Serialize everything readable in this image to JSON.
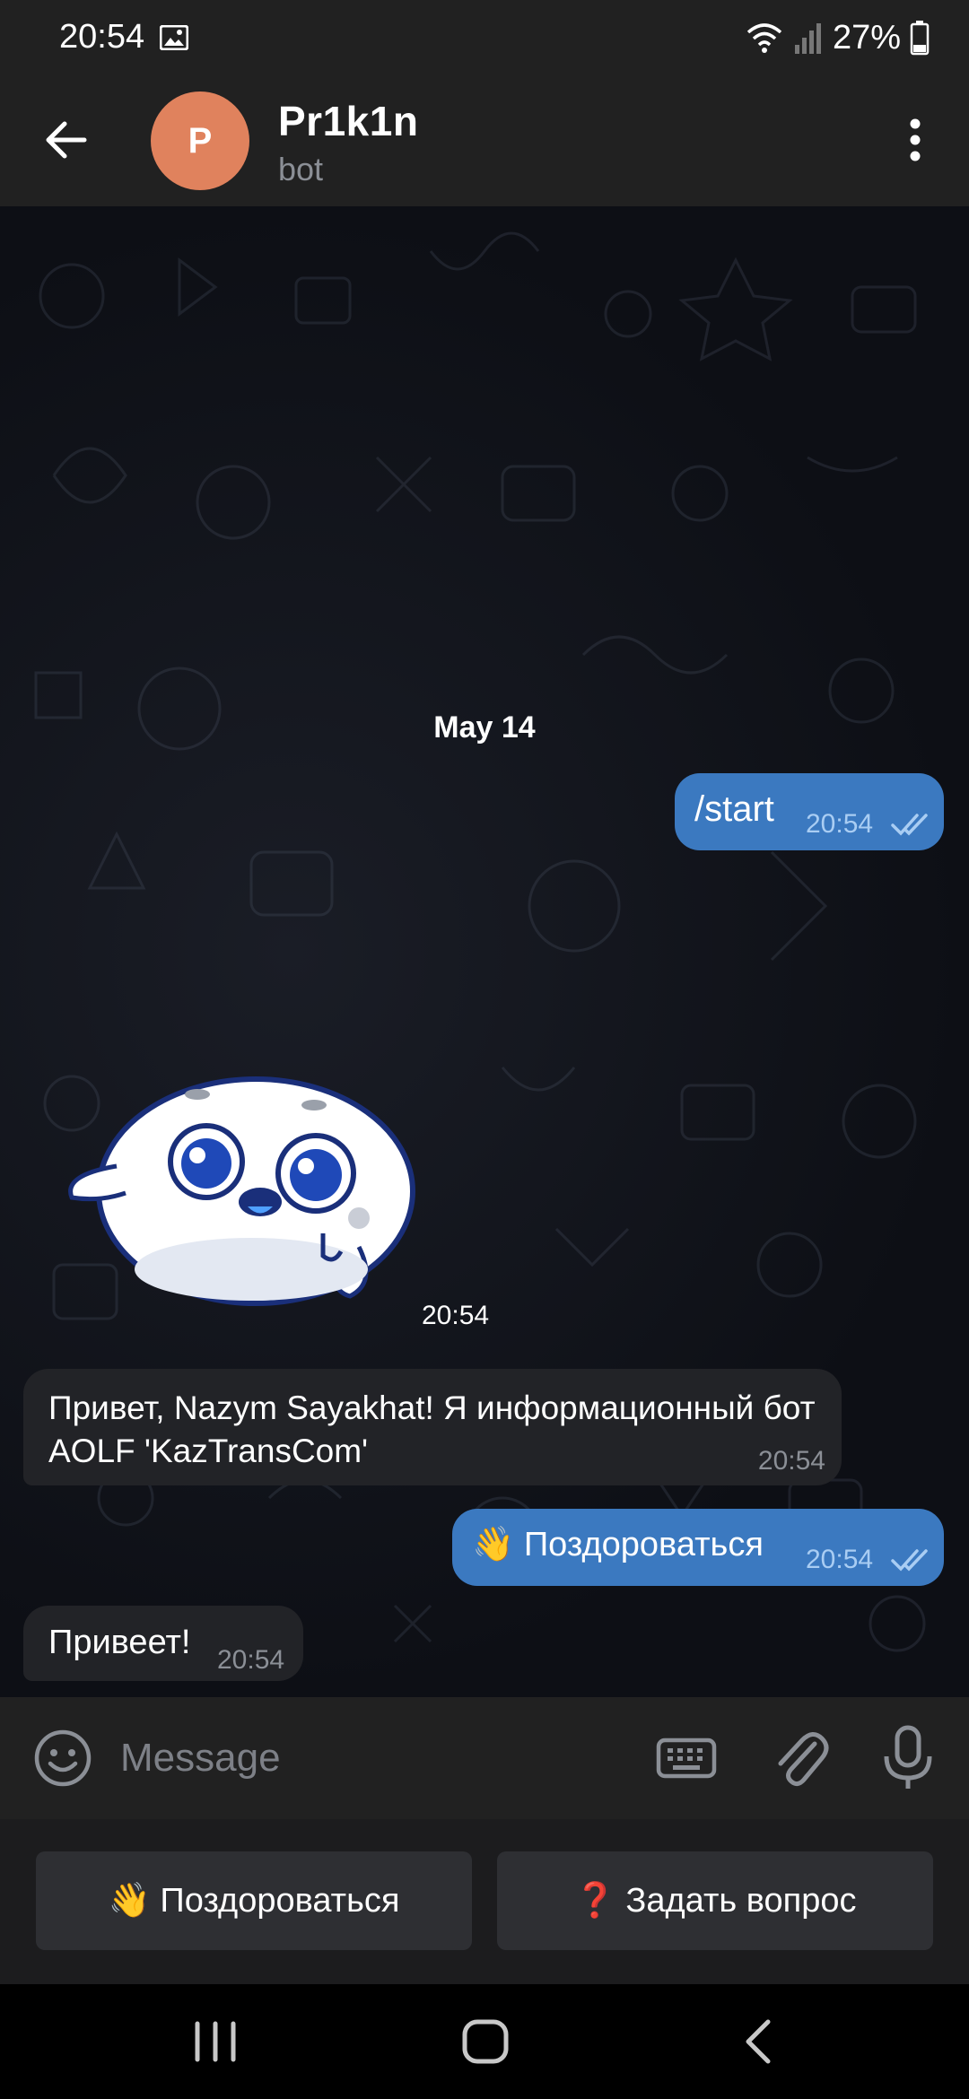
{
  "status_bar": {
    "time": "20:54",
    "battery": "27%"
  },
  "header": {
    "title": "Pr1k1n",
    "subtitle": "bot",
    "avatar_letter": "P",
    "avatar_color": "#e0825d"
  },
  "chat": {
    "date": "May 14",
    "messages": [
      {
        "direction": "out",
        "text": "/start",
        "time": "20:54"
      },
      {
        "direction": "in",
        "type": "sticker",
        "time": "20:54"
      },
      {
        "direction": "in",
        "text": "Привет, Nazym Sayakhat! Я информационный бот AOLF 'KazTransCom'",
        "time": "20:54"
      },
      {
        "direction": "out",
        "text": "👋 Поздороваться",
        "time": "20:54"
      },
      {
        "direction": "in",
        "text": "Привеет!",
        "time": "20:54"
      }
    ]
  },
  "input": {
    "placeholder": "Message"
  },
  "keyboard_buttons": [
    {
      "label": "👋 Поздороваться"
    },
    {
      "label": "❓ Задать вопрос"
    }
  ],
  "colors": {
    "outgoing_bubble": "#3b79c0",
    "incoming_bubble": "#222327",
    "bar_background": "#212121"
  }
}
